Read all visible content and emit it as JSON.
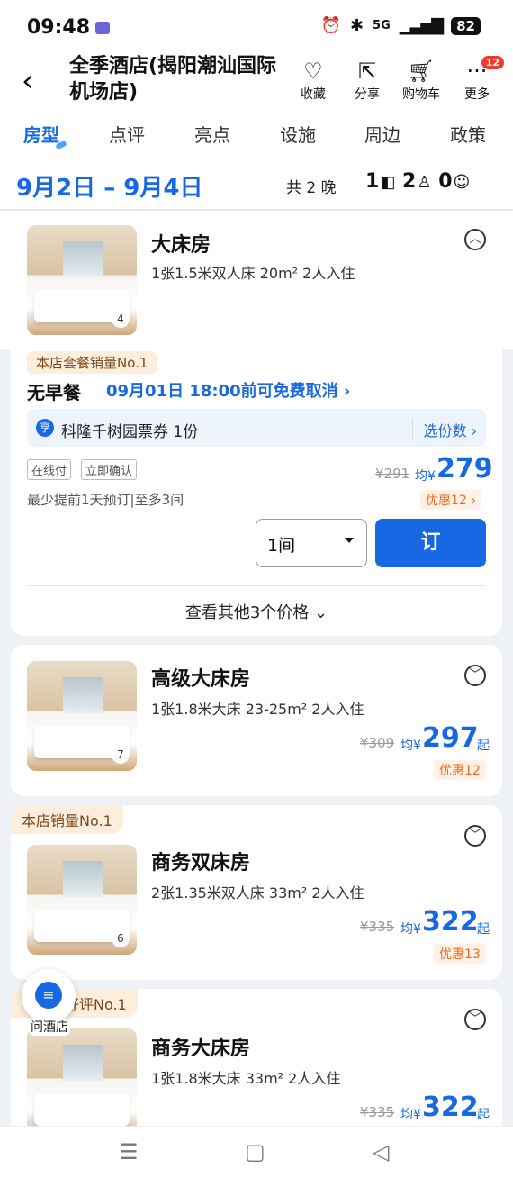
{
  "status": {
    "time": "09:48",
    "battery": "82",
    "network": "5G"
  },
  "header": {
    "title": "全季酒店(揭阳潮汕国际机场店)",
    "actions": [
      {
        "label": "收藏",
        "icon": "heart-plus-icon"
      },
      {
        "label": "分享",
        "icon": "share-icon"
      },
      {
        "label": "购物车",
        "icon": "cart-icon"
      },
      {
        "label": "更多",
        "icon": "more-icon",
        "badge": "12"
      }
    ]
  },
  "tabs": [
    "房型",
    "点评",
    "亮点",
    "设施",
    "周边",
    "政策"
  ],
  "datebar": {
    "dates": "9月2日 – 9月4日",
    "nights": "共 2 晚",
    "rooms": "1",
    "adults": "2",
    "children": "0"
  },
  "room1": {
    "name": "大床房",
    "desc": "1张1.5米双人床  20m²  2人入住",
    "photos": "4",
    "package": {
      "tag": "本店套餐销量No.1",
      "meal": "无早餐",
      "cancel": "09月01日 18:00前可免费取消 ›",
      "gift_icon": "享",
      "gift": "科隆千树园票券 1份",
      "gift_select": "选份数 ›",
      "pay": "在线付",
      "confirm": "立即确认",
      "advance": "最少提前1天预订|至多3间",
      "orig": "¥291",
      "avg": "均¥",
      "price": "279",
      "discount": "优惠12 ›",
      "qty": "1间",
      "book": "订",
      "more_prices": "查看其他3个价格 ⌄"
    }
  },
  "room2": {
    "name": "高级大床房",
    "desc": "1张1.8米大床  23-25m²  2人入住",
    "photos": "7",
    "orig": "¥309",
    "avg": "均¥",
    "price": "297",
    "qi": "起",
    "discount": "优惠12"
  },
  "room3": {
    "tag": "本店销量No.1",
    "name": "商务双床房",
    "desc": "2张1.35米双人床  33m²  2人入住",
    "photos": "6",
    "orig": "¥335",
    "avg": "均¥",
    "price": "322",
    "qi": "起",
    "discount": "优惠13"
  },
  "room4": {
    "tag": "好评No.1",
    "name": "商务大床房",
    "desc": "1张1.8米大床  33m²  2人入住",
    "orig": "¥335",
    "avg": "均¥",
    "price": "322",
    "qi": "起"
  },
  "ask": {
    "label": "问酒店"
  }
}
